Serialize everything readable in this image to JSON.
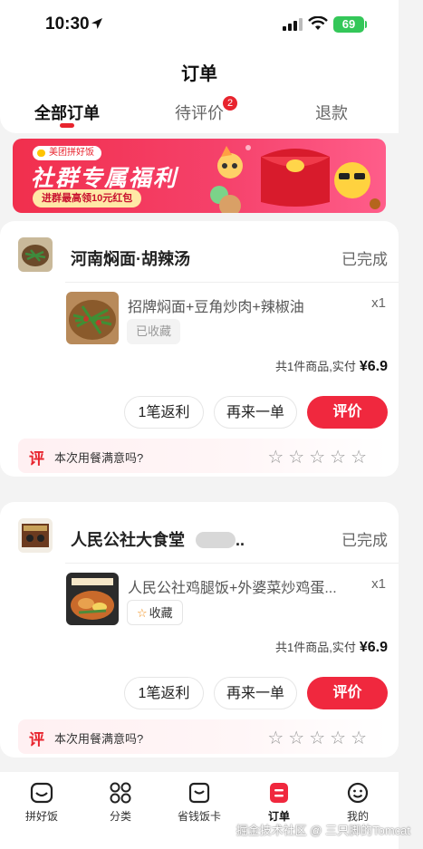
{
  "status_bar": {
    "time": "10:30",
    "battery": "69"
  },
  "header": {
    "title": "订单",
    "tabs": [
      {
        "label": "全部订单",
        "active": true
      },
      {
        "label": "待评价",
        "badge": "2"
      },
      {
        "label": "退款"
      }
    ]
  },
  "banner": {
    "brand": "美团拼好饭",
    "title": "社群专属福利",
    "subtitle": "进群最高领10元红包"
  },
  "orders": [
    {
      "shop_name": "河南焖面·胡辣汤",
      "status": "已完成",
      "item_name": "招牌焖面+豆角炒肉+辣椒油",
      "qty": "x1",
      "favorite": "已收藏",
      "summary": "共1件商品,实付",
      "price": "¥6.9",
      "btn_cashback": "1笔返利",
      "btn_reorder": "再来一单",
      "btn_review": "评价",
      "rate_icon": "评",
      "rate_prompt": "本次用餐满意吗?",
      "stars": "☆☆☆☆☆"
    },
    {
      "shop_name": "人民公社大食堂",
      "shop_name_suffix": "..",
      "status": "已完成",
      "item_name": "人民公社鸡腿饭+外婆菜炒鸡蛋...",
      "qty": "x1",
      "favorite": "收藏",
      "summary": "共1件商品,实付",
      "price": "¥6.9",
      "btn_cashback": "1笔返利",
      "btn_reorder": "再来一单",
      "btn_review": "评价",
      "rate_icon": "评",
      "rate_prompt": "本次用餐满意吗?",
      "stars": "☆☆☆☆☆"
    }
  ],
  "tabbar": {
    "items": [
      {
        "label": "拼好饭",
        "icon": "bowl-icon"
      },
      {
        "label": "分类",
        "icon": "grid-icon"
      },
      {
        "label": "省钱饭卡",
        "icon": "card-icon"
      },
      {
        "label": "订单",
        "icon": "order-icon",
        "active": true
      },
      {
        "label": "我的",
        "icon": "smiley-icon"
      }
    ]
  },
  "watermark": "掘金技术社区 @ 三只脚的Tomcat",
  "colors": {
    "accent": "#e8242e",
    "button_red": "#f0283e",
    "status_green": "#34c759"
  }
}
